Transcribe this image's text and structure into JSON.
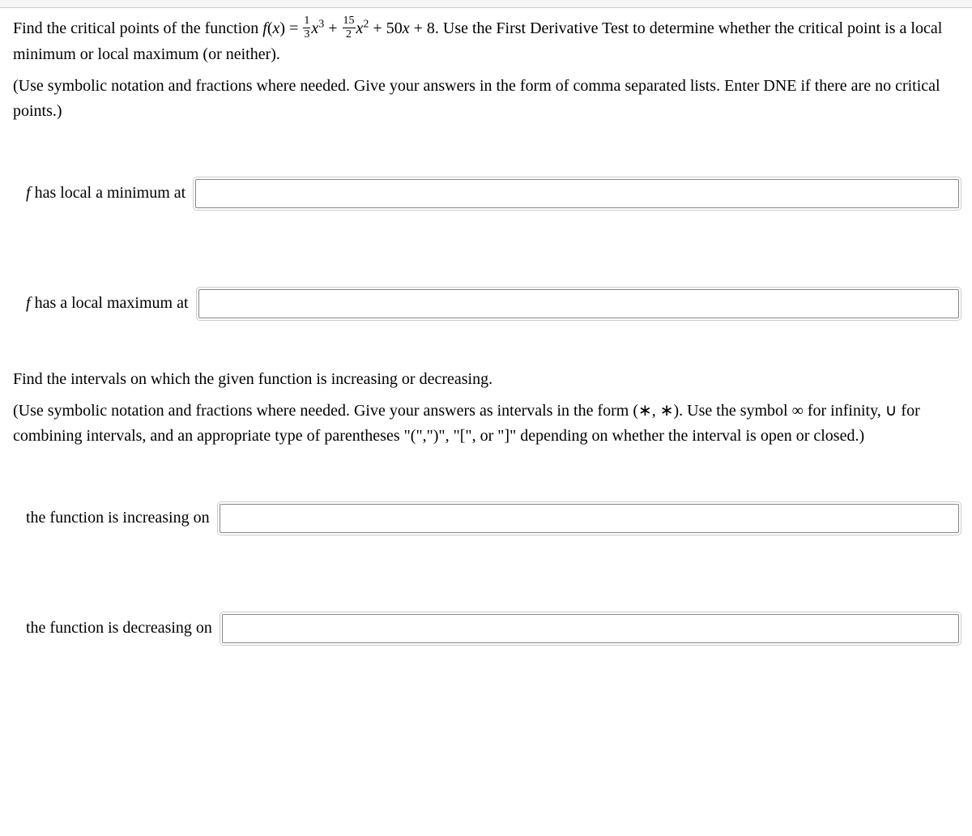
{
  "problem": {
    "intro_pre": "Find the critical points of the function ",
    "func_lhs_f": "f",
    "func_lhs_paren": "(",
    "func_lhs_x": "x",
    "func_lhs_close": ") = ",
    "frac1_num": "1",
    "frac1_den": "3",
    "term1_x": "x",
    "term1_exp": "3",
    "plus1": " + ",
    "frac2_num": "15",
    "frac2_den": "2",
    "term2_x": "x",
    "term2_exp": "2",
    "term_rest": " + 50",
    "term_rest_x": "x",
    "term_rest2": " + 8. ",
    "intro_post": "Use the First Derivative Test to determine whether the critical point is a local minimum or local maximum (or neither).",
    "note1": "(Use symbolic notation and fractions where needed. Give your answers in the form of comma separated lists. Enter DNE if there are no critical points.)"
  },
  "answers1": {
    "min_label_f": "f",
    "min_label_rest": " has local a minimum at",
    "min_value": "",
    "max_label_f": "f",
    "max_label_rest": " has a local maximum at",
    "max_value": ""
  },
  "problem2": {
    "prompt": "Find the intervals on which the given function is increasing or decreasing.",
    "note2": "(Use symbolic notation and fractions where needed. Give your answers as intervals in the form (∗, ∗). Use the symbol ∞ for infinity, ∪ for combining intervals, and an appropriate type of parentheses \"(\",\")\", \"[\", or \"]\" depending on whether the interval is open or closed.)"
  },
  "answers2": {
    "inc_label": "the function is increasing on",
    "inc_value": "",
    "dec_label": "the function is decreasing on",
    "dec_value": ""
  }
}
